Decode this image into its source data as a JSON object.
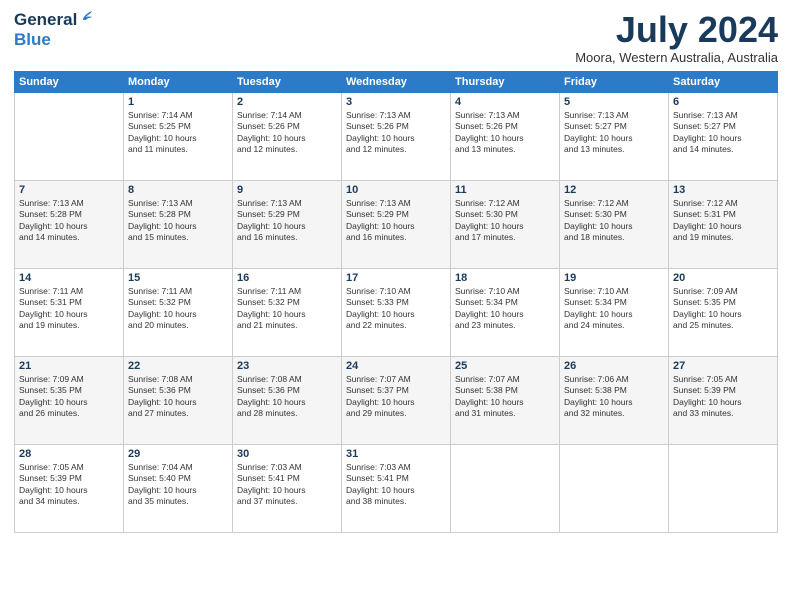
{
  "header": {
    "logo_line1": "General",
    "logo_line2": "Blue",
    "title": "July 2024",
    "location": "Moora, Western Australia, Australia"
  },
  "days_of_week": [
    "Sunday",
    "Monday",
    "Tuesday",
    "Wednesday",
    "Thursday",
    "Friday",
    "Saturday"
  ],
  "weeks": [
    [
      {
        "day": "",
        "content": ""
      },
      {
        "day": "1",
        "content": "Sunrise: 7:14 AM\nSunset: 5:25 PM\nDaylight: 10 hours\nand 11 minutes."
      },
      {
        "day": "2",
        "content": "Sunrise: 7:14 AM\nSunset: 5:26 PM\nDaylight: 10 hours\nand 12 minutes."
      },
      {
        "day": "3",
        "content": "Sunrise: 7:13 AM\nSunset: 5:26 PM\nDaylight: 10 hours\nand 12 minutes."
      },
      {
        "day": "4",
        "content": "Sunrise: 7:13 AM\nSunset: 5:26 PM\nDaylight: 10 hours\nand 13 minutes."
      },
      {
        "day": "5",
        "content": "Sunrise: 7:13 AM\nSunset: 5:27 PM\nDaylight: 10 hours\nand 13 minutes."
      },
      {
        "day": "6",
        "content": "Sunrise: 7:13 AM\nSunset: 5:27 PM\nDaylight: 10 hours\nand 14 minutes."
      }
    ],
    [
      {
        "day": "7",
        "content": "Sunrise: 7:13 AM\nSunset: 5:28 PM\nDaylight: 10 hours\nand 14 minutes."
      },
      {
        "day": "8",
        "content": "Sunrise: 7:13 AM\nSunset: 5:28 PM\nDaylight: 10 hours\nand 15 minutes."
      },
      {
        "day": "9",
        "content": "Sunrise: 7:13 AM\nSunset: 5:29 PM\nDaylight: 10 hours\nand 16 minutes."
      },
      {
        "day": "10",
        "content": "Sunrise: 7:13 AM\nSunset: 5:29 PM\nDaylight: 10 hours\nand 16 minutes."
      },
      {
        "day": "11",
        "content": "Sunrise: 7:12 AM\nSunset: 5:30 PM\nDaylight: 10 hours\nand 17 minutes."
      },
      {
        "day": "12",
        "content": "Sunrise: 7:12 AM\nSunset: 5:30 PM\nDaylight: 10 hours\nand 18 minutes."
      },
      {
        "day": "13",
        "content": "Sunrise: 7:12 AM\nSunset: 5:31 PM\nDaylight: 10 hours\nand 19 minutes."
      }
    ],
    [
      {
        "day": "14",
        "content": "Sunrise: 7:11 AM\nSunset: 5:31 PM\nDaylight: 10 hours\nand 19 minutes."
      },
      {
        "day": "15",
        "content": "Sunrise: 7:11 AM\nSunset: 5:32 PM\nDaylight: 10 hours\nand 20 minutes."
      },
      {
        "day": "16",
        "content": "Sunrise: 7:11 AM\nSunset: 5:32 PM\nDaylight: 10 hours\nand 21 minutes."
      },
      {
        "day": "17",
        "content": "Sunrise: 7:10 AM\nSunset: 5:33 PM\nDaylight: 10 hours\nand 22 minutes."
      },
      {
        "day": "18",
        "content": "Sunrise: 7:10 AM\nSunset: 5:34 PM\nDaylight: 10 hours\nand 23 minutes."
      },
      {
        "day": "19",
        "content": "Sunrise: 7:10 AM\nSunset: 5:34 PM\nDaylight: 10 hours\nand 24 minutes."
      },
      {
        "day": "20",
        "content": "Sunrise: 7:09 AM\nSunset: 5:35 PM\nDaylight: 10 hours\nand 25 minutes."
      }
    ],
    [
      {
        "day": "21",
        "content": "Sunrise: 7:09 AM\nSunset: 5:35 PM\nDaylight: 10 hours\nand 26 minutes."
      },
      {
        "day": "22",
        "content": "Sunrise: 7:08 AM\nSunset: 5:36 PM\nDaylight: 10 hours\nand 27 minutes."
      },
      {
        "day": "23",
        "content": "Sunrise: 7:08 AM\nSunset: 5:36 PM\nDaylight: 10 hours\nand 28 minutes."
      },
      {
        "day": "24",
        "content": "Sunrise: 7:07 AM\nSunset: 5:37 PM\nDaylight: 10 hours\nand 29 minutes."
      },
      {
        "day": "25",
        "content": "Sunrise: 7:07 AM\nSunset: 5:38 PM\nDaylight: 10 hours\nand 31 minutes."
      },
      {
        "day": "26",
        "content": "Sunrise: 7:06 AM\nSunset: 5:38 PM\nDaylight: 10 hours\nand 32 minutes."
      },
      {
        "day": "27",
        "content": "Sunrise: 7:05 AM\nSunset: 5:39 PM\nDaylight: 10 hours\nand 33 minutes."
      }
    ],
    [
      {
        "day": "28",
        "content": "Sunrise: 7:05 AM\nSunset: 5:39 PM\nDaylight: 10 hours\nand 34 minutes."
      },
      {
        "day": "29",
        "content": "Sunrise: 7:04 AM\nSunset: 5:40 PM\nDaylight: 10 hours\nand 35 minutes."
      },
      {
        "day": "30",
        "content": "Sunrise: 7:03 AM\nSunset: 5:41 PM\nDaylight: 10 hours\nand 37 minutes."
      },
      {
        "day": "31",
        "content": "Sunrise: 7:03 AM\nSunset: 5:41 PM\nDaylight: 10 hours\nand 38 minutes."
      },
      {
        "day": "",
        "content": ""
      },
      {
        "day": "",
        "content": ""
      },
      {
        "day": "",
        "content": ""
      }
    ]
  ]
}
